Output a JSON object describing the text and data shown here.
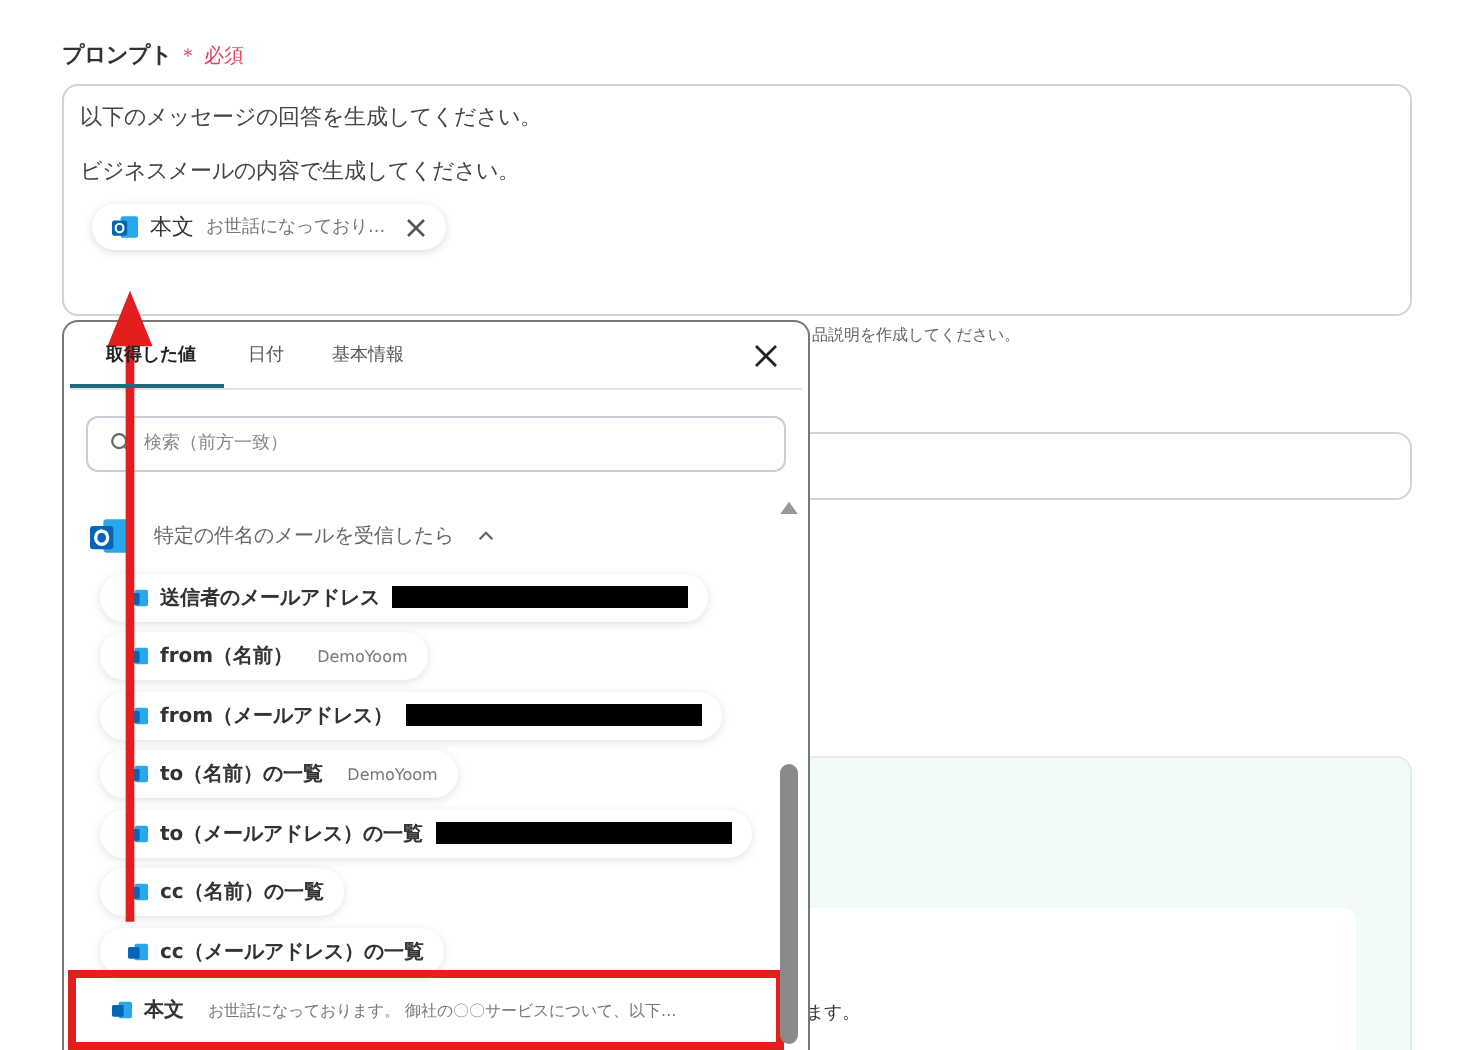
{
  "prompt": {
    "label": "プロンプト",
    "required": "＊ 必須",
    "lines": [
      "以下のメッセージの回答を生成してください。",
      "ビジネスメールの内容で生成してください。"
    ],
    "chip": {
      "label": "本文",
      "value": "お世話になっており..."
    },
    "hint": "品説明を作成してください。"
  },
  "card": {
    "text": "ます。"
  },
  "popup": {
    "tabs": [
      {
        "label": "取得した値",
        "selected": true
      },
      {
        "label": "日付",
        "selected": false
      },
      {
        "label": "基本情報",
        "selected": false
      }
    ],
    "search": {
      "placeholder": "検索（前方一致）"
    },
    "group": {
      "title": "特定の件名のメールを受信したら",
      "expanded": true
    },
    "items": [
      {
        "label": "送信者のメールアドレス",
        "redacted": true,
        "highlighted": false
      },
      {
        "label": "from（名前）",
        "value": "DemoYoom",
        "redacted": false,
        "highlighted": false
      },
      {
        "label": "from（メールアドレス）",
        "redacted": true,
        "highlighted": false
      },
      {
        "label": "to（名前）の一覧",
        "value": "DemoYoom",
        "redacted": false,
        "highlighted": false
      },
      {
        "label": "to（メールアドレス）の一覧",
        "redacted": true,
        "highlighted": false
      },
      {
        "label": "cc（名前）の一覧",
        "redacted": false,
        "highlighted": false
      },
      {
        "label": "cc（メールアドレス）の一覧",
        "redacted": false,
        "highlighted": false
      },
      {
        "label": "本文",
        "value": "お世話になっております。 御社の〇〇サービスについて、以下...",
        "redacted": false,
        "highlighted": true
      }
    ]
  }
}
